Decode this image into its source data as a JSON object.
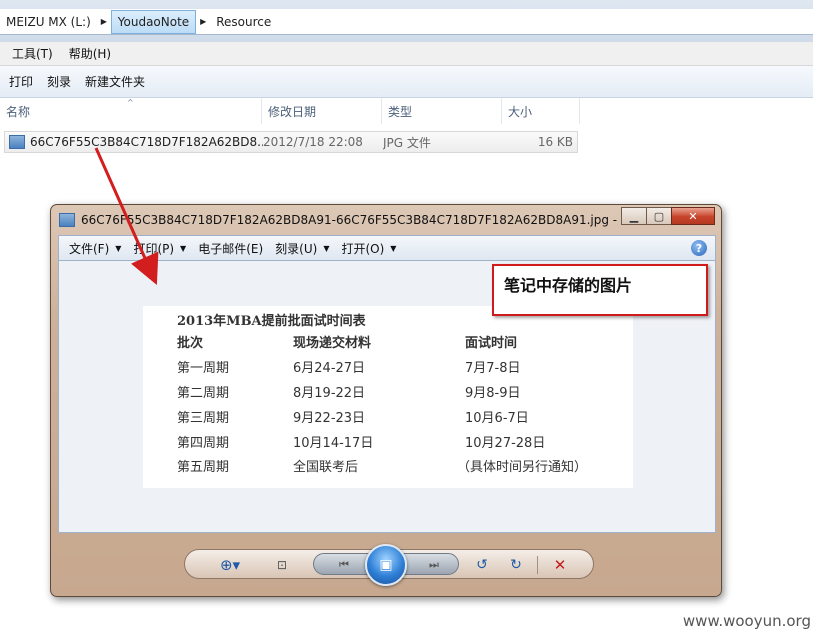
{
  "explorer": {
    "breadcrumb": [
      "MEIZU MX (L:)",
      "YoudaoNote",
      "Resource"
    ],
    "menu": [
      "工具(T)",
      "帮助(H)"
    ],
    "toolbar": [
      "打印",
      "刻录",
      "新建文件夹"
    ],
    "columns": [
      "名称",
      "修改日期",
      "类型",
      "大小"
    ],
    "file": {
      "name": "66C76F55C3B84C718D7F182A62BD8...",
      "date": "2012/7/18 22:08",
      "type": "JPG 文件",
      "size": "16 KB"
    }
  },
  "viewer": {
    "title": "66C76F55C3B84C718D7F182A62BD8A91-66C76F55C3B84C718D7F182A62BD8A91.jpg - ...",
    "window_buttons": [
      "▁",
      "▢",
      "✕"
    ],
    "menu": [
      "文件(F)",
      "打印(P)",
      "电子邮件(E)",
      "刻录(U)",
      "打开(O)"
    ],
    "help": "?",
    "image": {
      "title": "2013年MBA提前批面试时间表",
      "headers": [
        "批次",
        "现场递交材料",
        "面试时间"
      ],
      "rows": [
        [
          "第一周期",
          "6月24-27日",
          "7月7-8日"
        ],
        [
          "第二周期",
          "8月19-22日",
          "9月8-9日"
        ],
        [
          "第三周期",
          "9月22-23日",
          "10月6-7日"
        ],
        [
          "第四周期",
          "10月14-17日",
          "10月27-28日"
        ],
        [
          "第五周期",
          "全国联考后",
          "（具体时间另行通知）"
        ]
      ]
    }
  },
  "annotation": "笔记中存储的图片",
  "watermark": "www.wooyun.org",
  "icons": [
    "image-file-icon",
    "zoom-icon",
    "fit-window-icon",
    "previous-icon",
    "slideshow-icon",
    "next-icon",
    "rotate-left-icon",
    "rotate-right-icon",
    "delete-icon",
    "help-icon"
  ],
  "colors": {
    "annotation_red": "#d11a1a",
    "arrow_red": "#d21e1e",
    "viewer_frame": "#c7a88f"
  }
}
